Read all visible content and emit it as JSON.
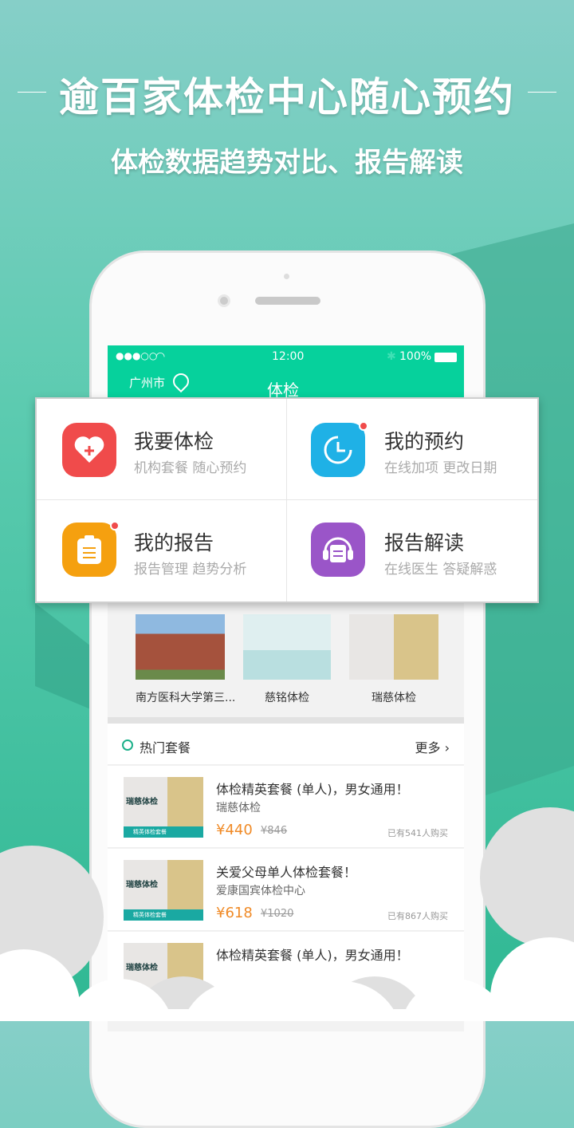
{
  "headline": "逾百家体检中心随心预约",
  "subheadline": "体检数据趋势对比、报告解读",
  "status_bar": {
    "signal": "●●●○○",
    "time": "12:00",
    "battery": "100%"
  },
  "nav": {
    "city": "广州市",
    "title": "体检"
  },
  "menu": [
    {
      "title": "我要体检",
      "subtitle": "机构套餐 随心预约",
      "icon": "heart-plus-icon",
      "color": "#f04b4b",
      "badge": false
    },
    {
      "title": "我的预约",
      "subtitle": "在线加项 更改日期",
      "icon": "clock-icon",
      "color": "#1fb1e6",
      "badge": true
    },
    {
      "title": "我的报告",
      "subtitle": "报告管理 趋势分析",
      "icon": "clipboard-icon",
      "color": "#f5a00f",
      "badge": true
    },
    {
      "title": "报告解读",
      "subtitle": "在线医生 答疑解惑",
      "icon": "headset-icon",
      "color": "#9a55c8",
      "badge": false
    }
  ],
  "hospitals": [
    {
      "name": "南方医科大学第三..."
    },
    {
      "name": "慈铭体检"
    },
    {
      "name": "瑞慈体检"
    }
  ],
  "hot": {
    "title": "热门套餐",
    "more": "更多"
  },
  "packages": [
    {
      "title": "体检精英套餐 (单人)，男女通用！",
      "org": "瑞慈体检",
      "price": "¥440",
      "orig": "¥846",
      "sold": "已有541人购买",
      "thumb_text": "瑞慈体检",
      "thumb_bar": "精英体检套餐"
    },
    {
      "title": "关爱父母单人体检套餐！",
      "org": "爱康国宾体检中心",
      "price": "¥618",
      "orig": "¥1020",
      "sold": "已有867人购买",
      "thumb_text": "瑞慈体检",
      "thumb_bar": "精英体检套餐"
    },
    {
      "title": "体检精英套餐 (单人)，男女通用！",
      "thumb_text": "瑞慈体检"
    }
  ]
}
